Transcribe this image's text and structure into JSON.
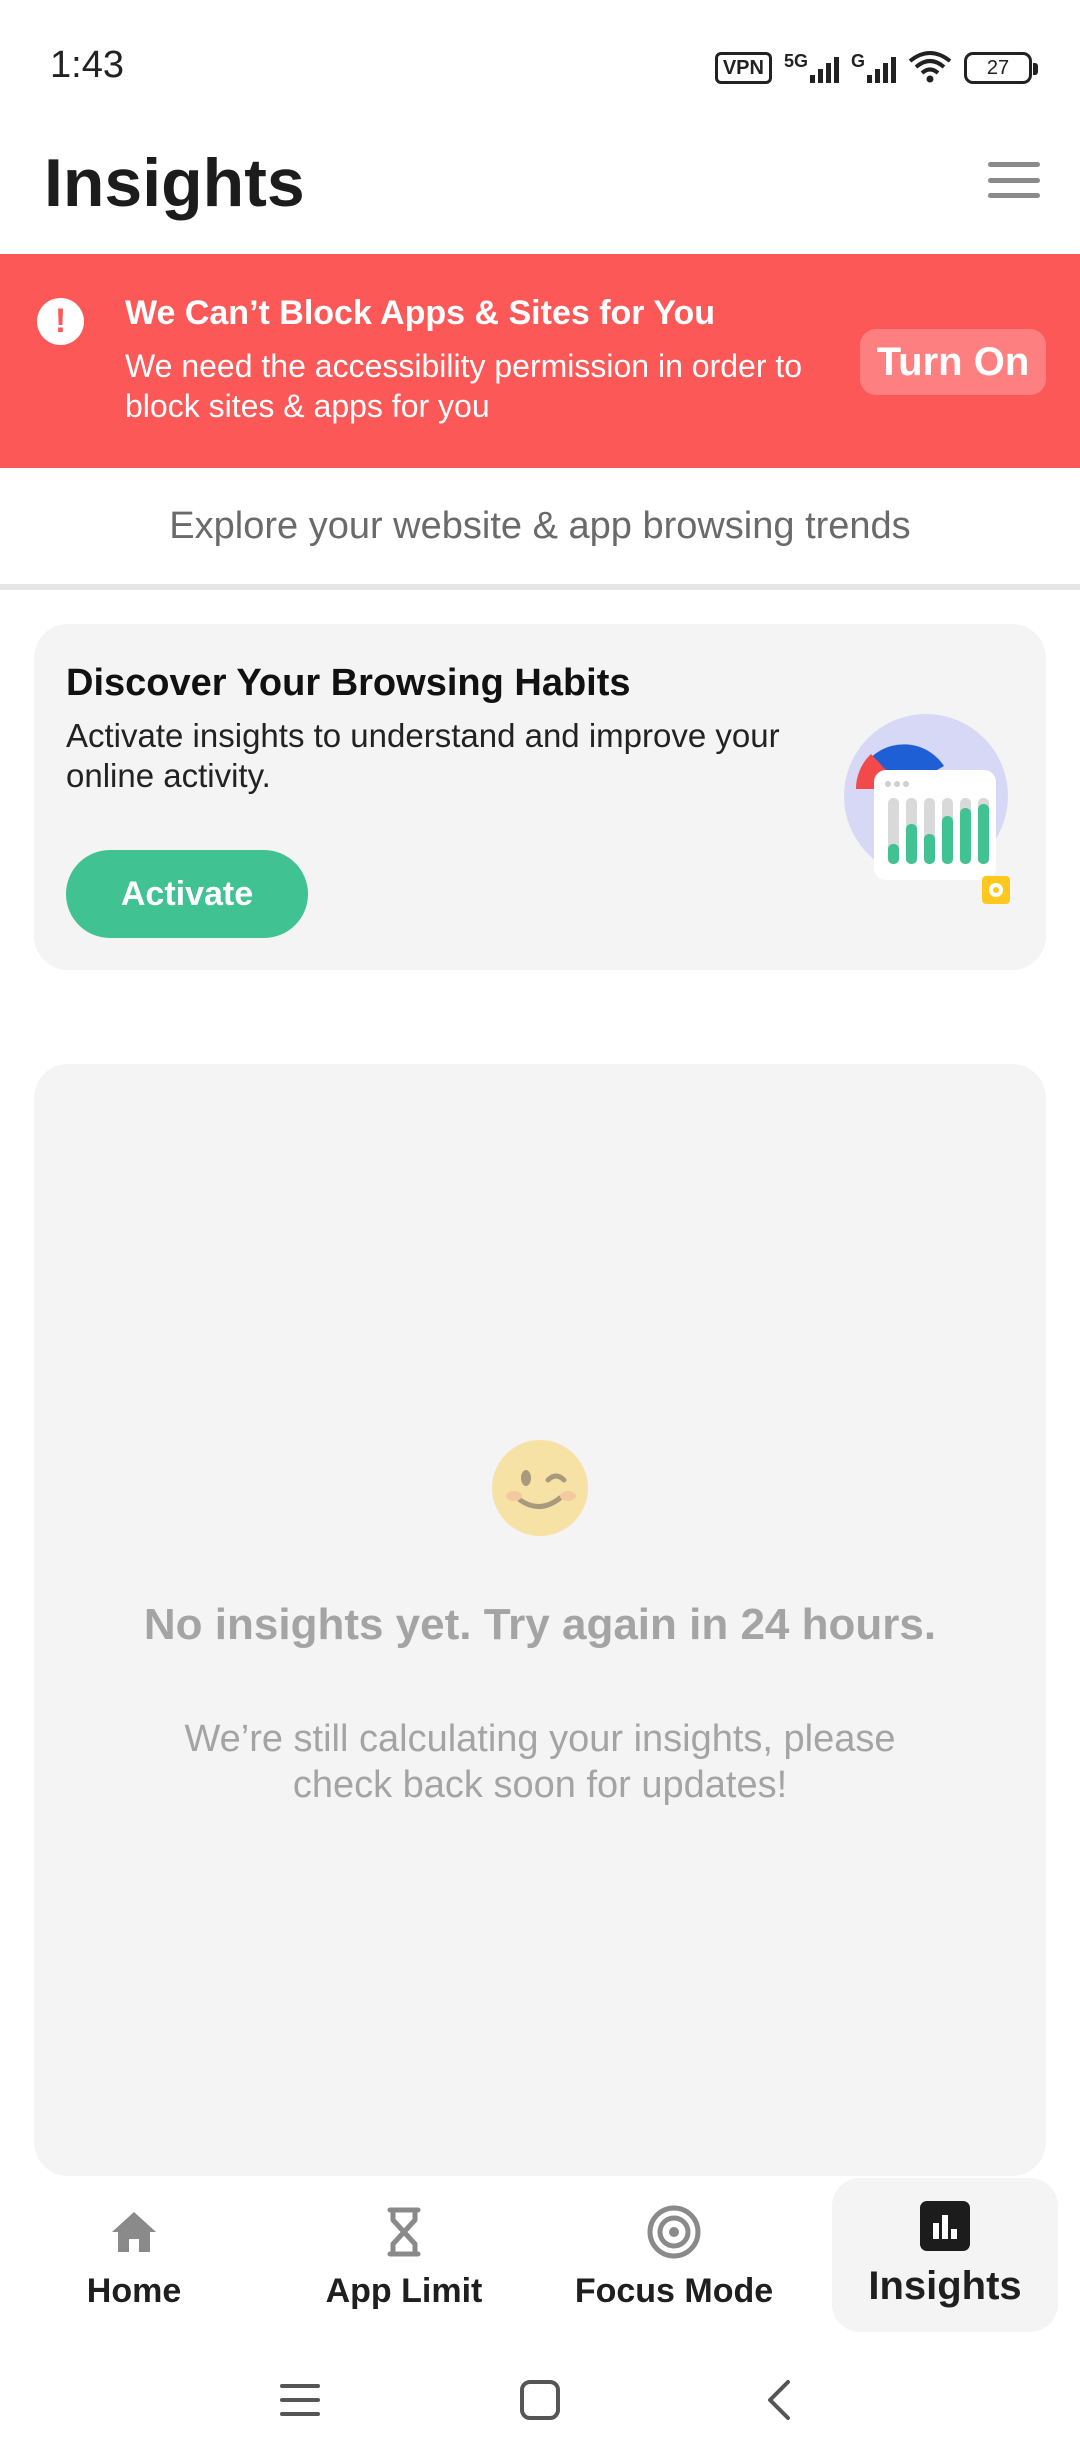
{
  "status_bar": {
    "time": "1:43",
    "vpn": "VPN",
    "network_1": "5G",
    "network_2": "G",
    "battery": "27"
  },
  "header": {
    "title": "Insights",
    "menu_icon": "hamburger-menu-icon"
  },
  "alert": {
    "icon": "exclamation-icon",
    "title": "We Can’t Block Apps & Sites for You",
    "body": "We need the accessibility permission in order to block sites & apps for you",
    "button": "Turn On",
    "color": "#fd5858"
  },
  "subtitle": "Explore your website & app browsing trends",
  "discover": {
    "title": "Discover Your Browsing Habits",
    "description": "Activate insights to understand and improve your online activity.",
    "button": "Activate",
    "button_color": "#41c293",
    "illustration": "insights-chart-illustration"
  },
  "empty_state": {
    "emoji": "wink-emoji",
    "title": "No insights yet. Try again in 24 hours.",
    "description": "We’re still calculating your insights, please check back soon for updates!"
  },
  "bottom_nav": {
    "items": [
      {
        "label": "Home",
        "icon": "home-icon"
      },
      {
        "label": "App Limit",
        "icon": "hourglass-icon"
      },
      {
        "label": "Focus Mode",
        "icon": "target-icon"
      },
      {
        "label": "Insights",
        "icon": "bar-chart-icon",
        "active": true
      }
    ]
  },
  "system_nav": {
    "buttons": [
      "recent-apps-icon",
      "home-button-icon",
      "back-icon"
    ]
  }
}
